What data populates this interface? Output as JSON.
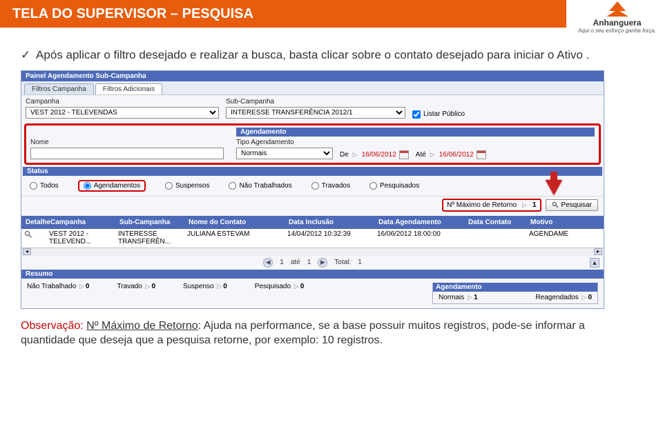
{
  "header": {
    "title": "TELA DO SUPERVISOR – PESQUISA"
  },
  "logo": {
    "name": "Anhanguera",
    "slogan": "Aqui o seu esforço ganha força."
  },
  "intro": {
    "text": "Após aplicar o filtro desejado e realizar a busca, basta clicar sobre o contato desejado para iniciar o Ativo ."
  },
  "panel": {
    "title": "Painel Agendamento Sub-Campanha",
    "tabs": [
      "Filtros Campanha",
      "Filtros Adicionais"
    ],
    "active_tab": 1,
    "campanha_label": "Campanha",
    "campanha_value": "VEST 2012 - TELEVENDAS",
    "subcampanha_label": "Sub-Campanha",
    "subcampanha_value": "INTERESSE TRANSFERÊNCIA 2012/1",
    "listar_publico_label": "Listar Público",
    "listar_publico_checked": true,
    "nome_label": "Nome",
    "nome_value": "",
    "agendamento_section": "Agendamento",
    "tipo_label": "Tipo Agendamento",
    "tipo_value": "Normais",
    "de_label": "De",
    "de_value": "16/06/2012",
    "ate_label": "Até",
    "ate_value": "16/06/2012",
    "status": {
      "section": "Status",
      "options": [
        "Todos",
        "Agendamentos",
        "Suspensos",
        "Não Trabalhados",
        "Travados",
        "Pesquisados"
      ],
      "selected": 1
    },
    "max_retorno_label": "Nº Máximo de Retorno",
    "max_retorno_value": "1",
    "pesquisar_label": "Pesquisar",
    "table": {
      "headers": [
        "Detalhe",
        "Campanha",
        "Sub-Campanha",
        "Nome do Contato",
        "Data Inclusão",
        "Data Agendamento",
        "Data Contato",
        "Motivo"
      ],
      "row": {
        "campanha": "VEST 2012 - TELEVEND...",
        "sub": "INTERESSE TRANSFERÊN...",
        "nome": "JULIANA ESTEVAM",
        "inclusao": "14/04/2012 10:32:39",
        "agend": "16/06/2012 18:00:00",
        "contato": "",
        "motivo": "AGENDAME"
      }
    },
    "pager": {
      "page": "1",
      "to_label": "até",
      "total_pages": "1",
      "total_label": "Total:",
      "total": "1"
    },
    "resumo": {
      "section": "Resumo",
      "nao_trab": "Não Trabalhado",
      "nao_trab_v": "0",
      "travado": "Travado",
      "travado_v": "0",
      "suspenso": "Suspenso",
      "suspenso_v": "0",
      "pesquisado": "Pesquisado",
      "pesquisado_v": "0",
      "normais": "Normais",
      "normais_v": "1",
      "reagend": "Reagendados",
      "reagend_v": "0"
    }
  },
  "note": {
    "obs": "Observação:",
    "title": "Nº Máximo de Retorno",
    "rest1": ": Ajuda na performance, se a base possuir muitos registros, pode-se informar a quantidade que deseja que a pesquisa retorne, por exemplo: 10 registros."
  }
}
